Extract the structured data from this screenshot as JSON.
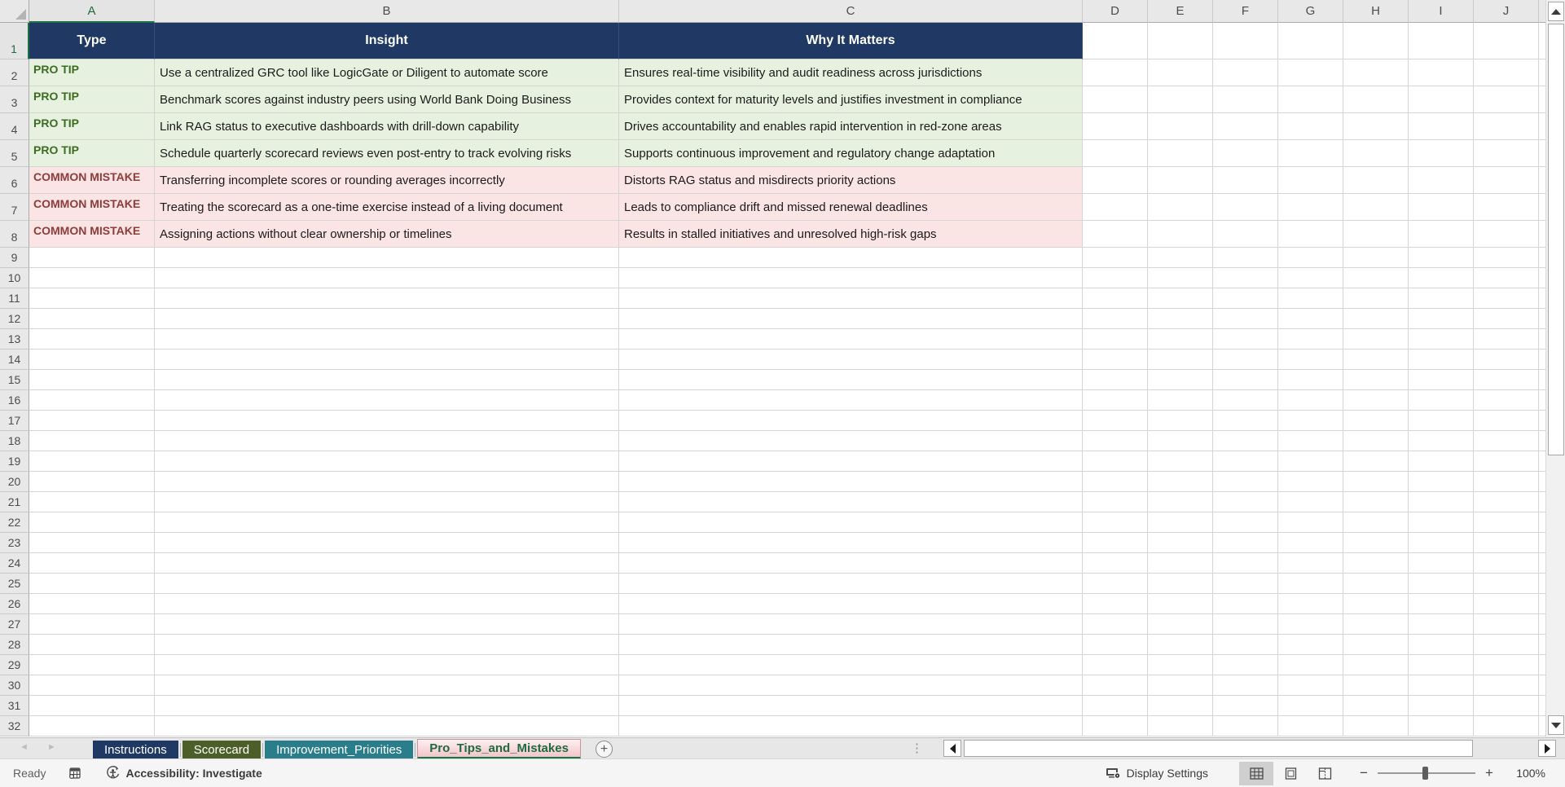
{
  "grid": {
    "column_letters": [
      "A",
      "B",
      "C",
      "D",
      "E",
      "F",
      "G",
      "H",
      "I",
      "J"
    ],
    "row_numbers": [
      1,
      2,
      3,
      4,
      5,
      6,
      7,
      8,
      9,
      10,
      11,
      12,
      13,
      14,
      15,
      16,
      17,
      18,
      19,
      20,
      21,
      22,
      23,
      24,
      25,
      26,
      27,
      28,
      29,
      30,
      31,
      32
    ],
    "selected_cell": "A1"
  },
  "table": {
    "header_row": [
      "Type",
      "Insight",
      "Why It Matters"
    ],
    "rows": [
      {
        "type": "PRO TIP",
        "kind": "tip",
        "insight": "Use a centralized GRC tool like LogicGate or Diligent to automate score",
        "why": "Ensures real-time visibility and audit readiness across jurisdictions"
      },
      {
        "type": "PRO TIP",
        "kind": "tip",
        "insight": "Benchmark scores against industry peers using World Bank Doing Business",
        "why": "Provides context for maturity levels and justifies investment in compliance"
      },
      {
        "type": "PRO TIP",
        "kind": "tip",
        "insight": "Link RAG status to executive dashboards with drill-down capability",
        "why": "Drives accountability and enables rapid intervention in red-zone areas"
      },
      {
        "type": "PRO TIP",
        "kind": "tip",
        "insight": "Schedule quarterly scorecard reviews even post-entry to track evolving risks",
        "why": "Supports continuous improvement and regulatory change adaptation"
      },
      {
        "type": "COMMON MISTAKE",
        "kind": "mistake",
        "insight": "Transferring incomplete scores or rounding averages incorrectly",
        "why": "Distorts RAG status and misdirects priority actions"
      },
      {
        "type": "COMMON MISTAKE",
        "kind": "mistake",
        "insight": "Treating the scorecard as a one-time exercise instead of a living document",
        "why": "Leads to compliance drift and missed renewal deadlines"
      },
      {
        "type": "COMMON MISTAKE",
        "kind": "mistake",
        "insight": "Assigning actions without clear ownership or timelines",
        "why": "Results in stalled initiatives and unresolved high-risk gaps"
      }
    ]
  },
  "sheet_tabs": {
    "tabs": [
      {
        "label": "Instructions",
        "bg": "#1F3864",
        "text_color": "#FFFFFF",
        "active": false
      },
      {
        "label": "Scorecard",
        "bg": "#4D5F28",
        "text_color": "#FFFFFF",
        "active": false
      },
      {
        "label": "Improvement_Priorities",
        "bg": "#2A7E8B",
        "text_color": "#FFFFFF",
        "active": false
      },
      {
        "label": "Pro_Tips_and_Mistakes",
        "bg": "#F3C5CA",
        "text_color": "#1E6B41",
        "active": true
      }
    ]
  },
  "status_bar": {
    "ready_label": "Ready",
    "accessibility_label": "Accessibility: Investigate",
    "display_settings_label": "Display Settings",
    "zoom_level": "100%"
  },
  "colors": {
    "header_fill": "#1F3864",
    "header_text": "#FFFFFF",
    "tip_fill": "#E6F2DF",
    "tip_text": "#3E6B22",
    "mistake_fill": "#FBE4E4",
    "mistake_text": "#8E3B3B",
    "selection_green": "#1E7145",
    "active_tab_underline": "#187647"
  }
}
